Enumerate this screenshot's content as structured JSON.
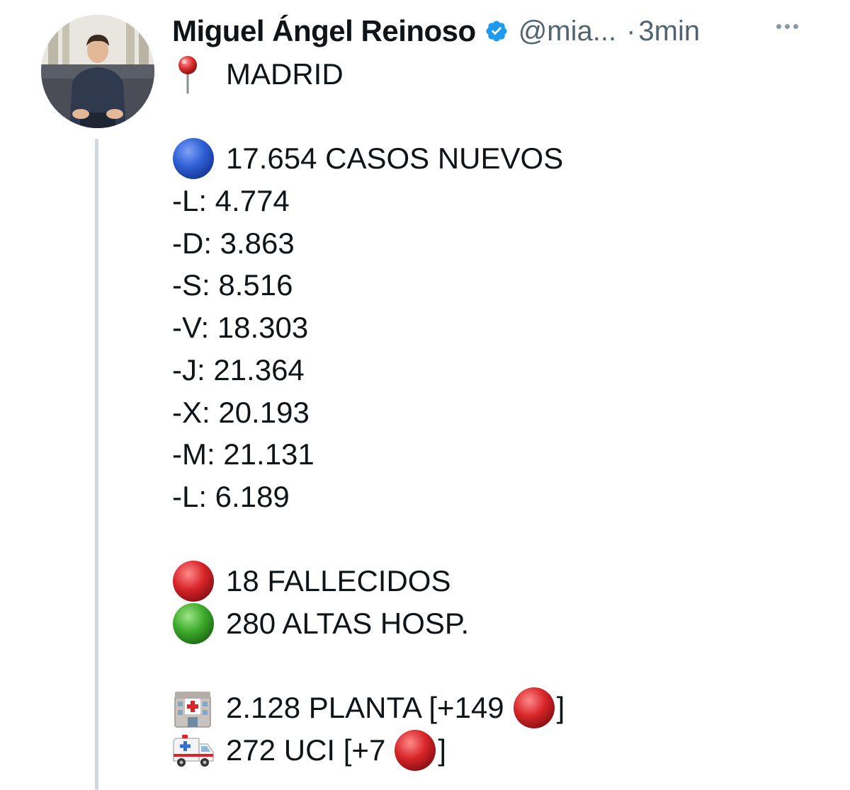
{
  "author": {
    "name": "Miguel Ángel Reinoso",
    "handle": "@mia...",
    "separator": "·",
    "time": "3min"
  },
  "tweet": {
    "location": "MADRID",
    "new_cases": "17.654 CASOS NUEVOS",
    "daily": [
      "-L: 4.774",
      "-D: 3.863",
      "-S: 8.516",
      "-V: 18.303",
      "-J: 21.364",
      "-X: 20.193",
      "-M: 21.131",
      "-L: 6.189"
    ],
    "deaths": "18 FALLECIDOS",
    "discharges": "280 ALTAS HOSP.",
    "ward": {
      "text": "2.128 PLANTA [+149",
      "close": "]"
    },
    "icu": {
      "text": "272 UCI [+7",
      "close": "]"
    }
  },
  "icons": {
    "verified": "verified-badge-icon",
    "pin": "round-pushpin-icon",
    "blue": "blue-circle-icon",
    "red": "red-circle-icon",
    "green": "green-circle-icon",
    "hospital": "hospital-icon",
    "ambulance": "ambulance-icon",
    "more": "more-options-icon"
  },
  "colors": {
    "verified": "#1d9bf0",
    "thread_line": "#cfd9de",
    "secondary_text": "#536471",
    "blue_circle": "#2f5fd6",
    "red_circle": "#d8262a",
    "green_circle": "#3dab2c"
  }
}
